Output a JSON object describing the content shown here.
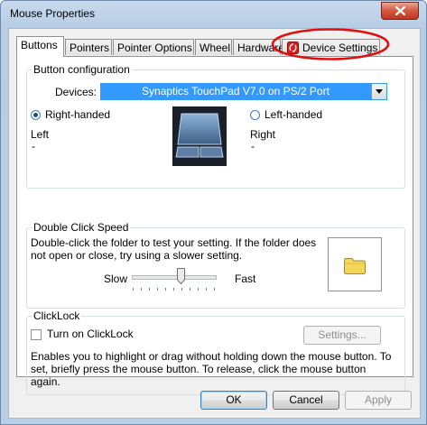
{
  "window": {
    "title": "Mouse Properties",
    "close_icon": "close-x-icon"
  },
  "tabs": [
    {
      "label": "Buttons",
      "active": true
    },
    {
      "label": "Pointers"
    },
    {
      "label": "Pointer Options"
    },
    {
      "label": "Wheel"
    },
    {
      "label": "Hardware"
    },
    {
      "label": "Device Settings",
      "icon": "synaptics-icon",
      "highlighted": true
    }
  ],
  "button_config": {
    "group_label": "Button configuration",
    "devices_label": "Devices:",
    "devices_value": "Synaptics TouchPad V7.0 on PS/2 Port",
    "right_handed_label": "Right-handed",
    "left_handed_label": "Left-handed",
    "selected": "Right-handed",
    "left_caption": "Left",
    "left_value": "-",
    "right_caption": "Right",
    "right_value": "-",
    "image_icon": "touchpad-icon"
  },
  "double_click": {
    "group_label": "Double Click Speed",
    "description": "Double-click the folder to test your setting.  If the folder does not open or close, try using a slower setting.",
    "slow_label": "Slow",
    "fast_label": "Fast",
    "speed_fraction": 0.6,
    "folder_icon": "folder-icon"
  },
  "clicklock": {
    "group_label": "ClickLock",
    "checkbox_label": "Turn on ClickLock",
    "checked": false,
    "settings_button": "Settings...",
    "description": "Enables you to highlight or drag without holding down the mouse button.  To set, briefly press the mouse button.  To release, click the mouse button again."
  },
  "footer": {
    "ok": "OK",
    "cancel": "Cancel",
    "apply": "Apply"
  },
  "colors": {
    "accent": "#3399ff",
    "highlight_ring": "#e01010",
    "window_frame": "#b9cfe7"
  }
}
